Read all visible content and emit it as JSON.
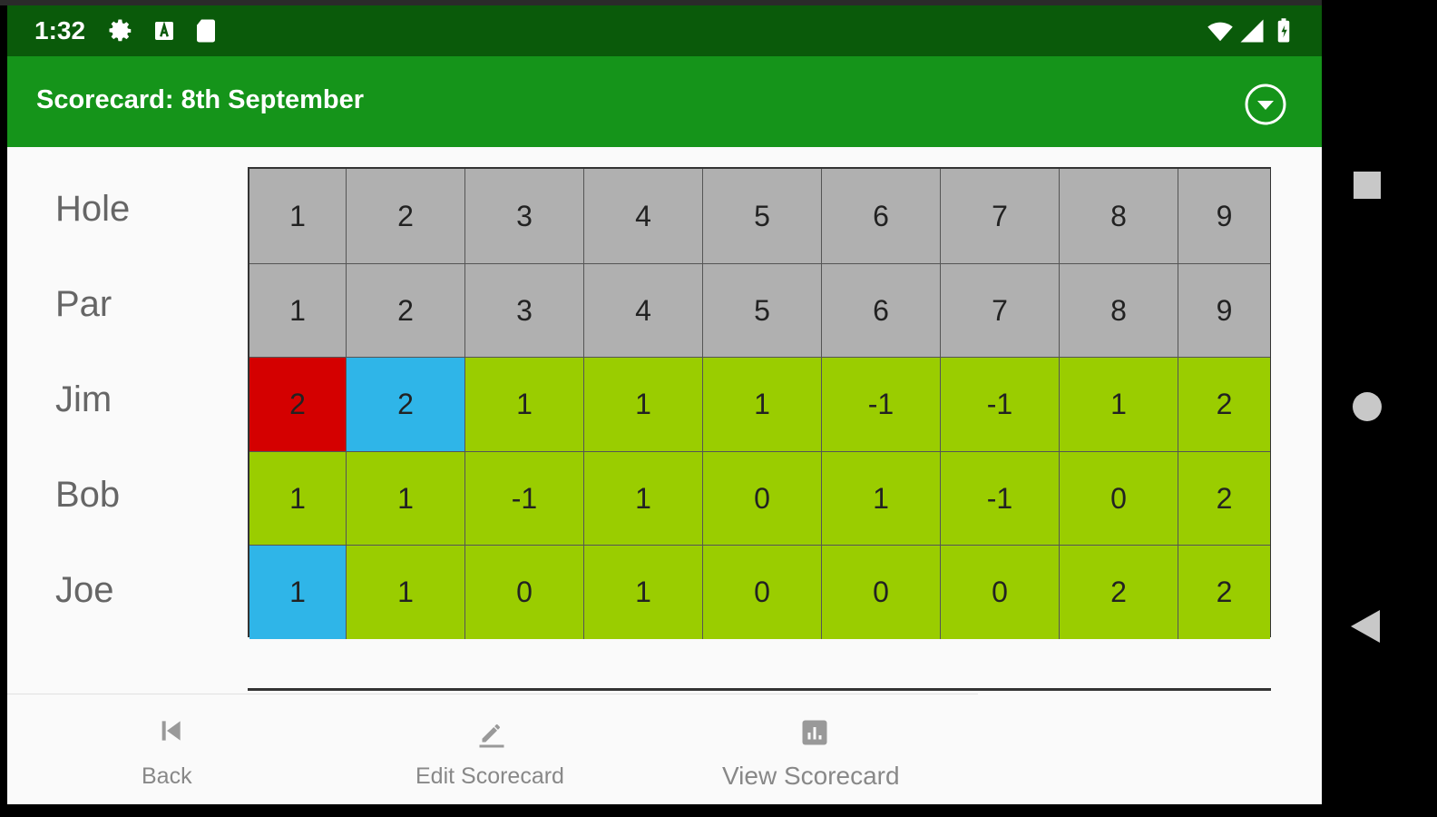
{
  "status_bar": {
    "time": "1:32"
  },
  "app_bar": {
    "title": "Scorecard: 8th September"
  },
  "scorecard": {
    "row_labels": [
      "Hole",
      "Par",
      "Jim",
      "Bob",
      "Joe"
    ],
    "rows": [
      [
        "1",
        "2",
        "3",
        "4",
        "5",
        "6",
        "7",
        "8",
        "9"
      ],
      [
        "1",
        "2",
        "3",
        "4",
        "5",
        "6",
        "7",
        "8",
        "9"
      ],
      [
        "2",
        "2",
        "1",
        "1",
        "1",
        "-1",
        "-1",
        "1",
        "2"
      ],
      [
        "1",
        "1",
        "-1",
        "1",
        "0",
        "1",
        "-1",
        "0",
        "2"
      ],
      [
        "1",
        "1",
        "0",
        "1",
        "0",
        "0",
        "0",
        "2",
        "2"
      ]
    ],
    "cell_colors": [
      [
        "gray",
        "gray",
        "gray",
        "gray",
        "gray",
        "gray",
        "gray",
        "gray",
        "gray"
      ],
      [
        "gray",
        "gray",
        "gray",
        "gray",
        "gray",
        "gray",
        "gray",
        "gray",
        "gray"
      ],
      [
        "red",
        "blue",
        "green",
        "green",
        "green",
        "green",
        "green",
        "green",
        "green"
      ],
      [
        "green",
        "green",
        "green",
        "green",
        "green",
        "green",
        "green",
        "green",
        "green"
      ],
      [
        "blue",
        "green",
        "green",
        "green",
        "green",
        "green",
        "green",
        "green",
        "green"
      ]
    ]
  },
  "colors": {
    "gray": "#b0b0b0",
    "red": "#d40000",
    "blue": "#2fb5e8",
    "green": "#9acd00",
    "status_bar": "#0a5a0a",
    "app_bar": "#15941a"
  },
  "bottom_nav": {
    "back": "Back",
    "edit": "Edit Scorecard",
    "view": "View Scorecard"
  }
}
